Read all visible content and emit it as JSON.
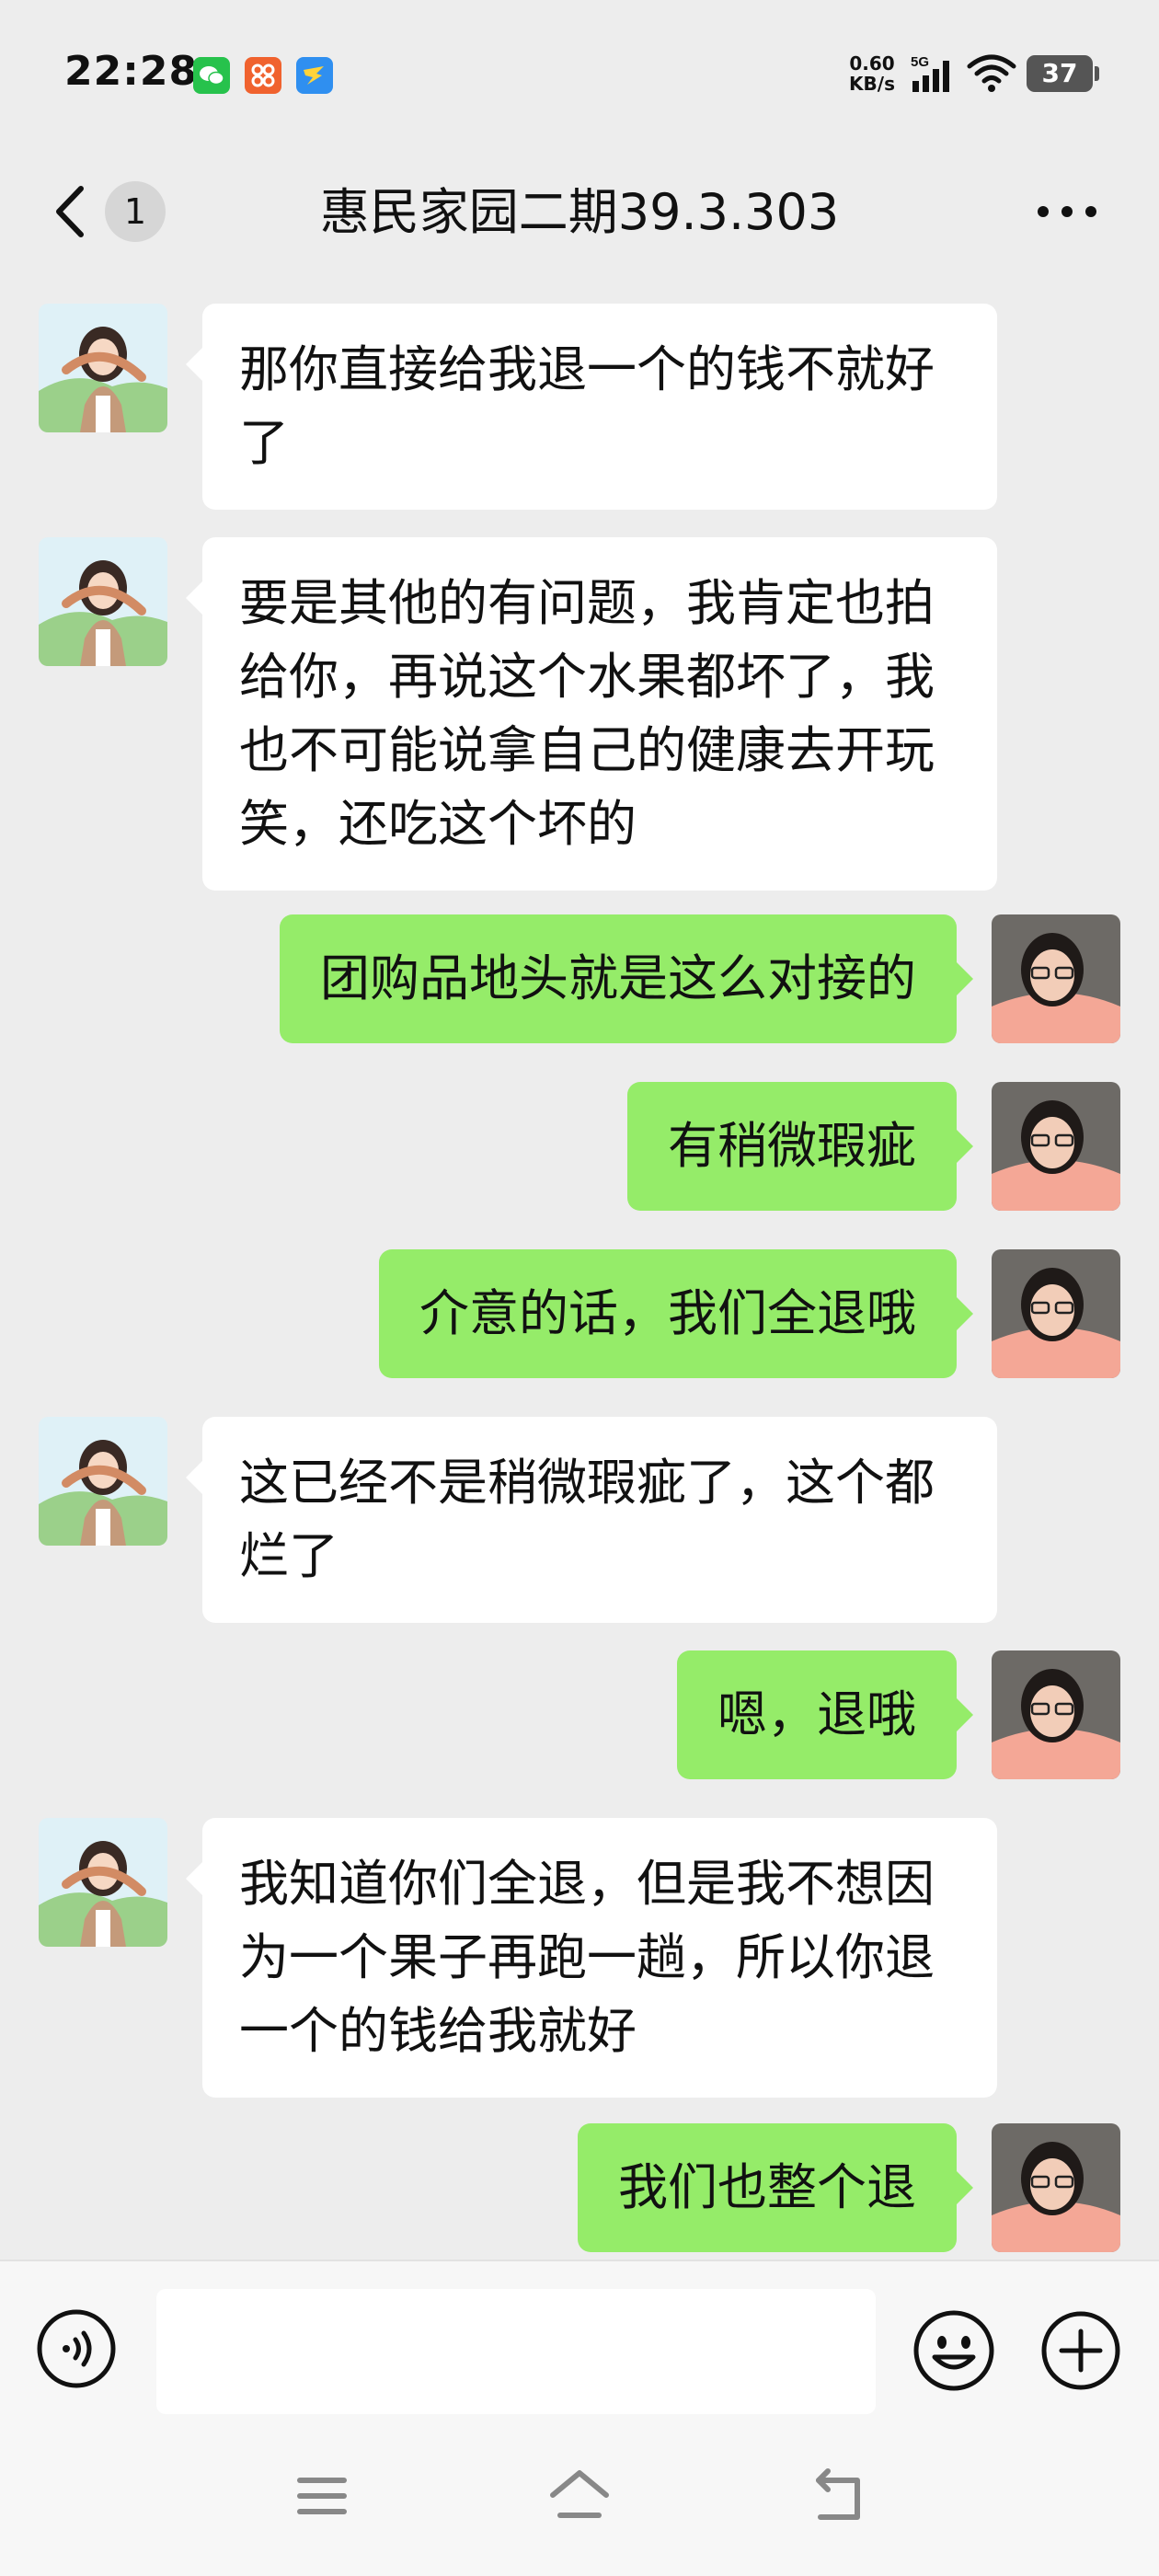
{
  "status_bar": {
    "time": "22:28",
    "net_speed_value": "0.60",
    "net_speed_unit": "KB/s",
    "network_type": "5G",
    "battery_level": "37",
    "notification_icons": [
      "wechat-icon",
      "app-grid-icon",
      "bird-app-icon"
    ]
  },
  "header": {
    "back_icon": "chevron-left-icon",
    "unread_count": "1",
    "title": "惠民家园二期39.3.303",
    "more_icon": "more-dots-icon"
  },
  "messages": [
    {
      "direction": "incoming",
      "text": "那你直接给我退一个的钱不就好了"
    },
    {
      "direction": "incoming",
      "text": "要是其他的有问题，我肯定也拍给你，再说这个水果都坏了，我也不可能说拿自己的健康去开玩笑，还吃这个坏的"
    },
    {
      "direction": "outgoing",
      "text": "团购品地头就是这么对接的"
    },
    {
      "direction": "outgoing",
      "text": "有稍微瑕疵"
    },
    {
      "direction": "outgoing",
      "text": "介意的话，我们全退哦"
    },
    {
      "direction": "incoming",
      "text": "这已经不是稍微瑕疵了，这个都烂了"
    },
    {
      "direction": "outgoing",
      "text": "嗯，退哦"
    },
    {
      "direction": "incoming",
      "text": "我知道你们全退，但是我不想因为一个果子再跑一趟，所以你退一个的钱给我就好"
    },
    {
      "direction": "outgoing",
      "text": "我们也整个退"
    }
  ],
  "input_bar": {
    "voice_icon": "voice-input-icon",
    "input_value": "",
    "emoji_icon": "emoji-icon",
    "plus_icon": "plus-circle-icon"
  },
  "nav_bar": {
    "icons": [
      "menu-icon",
      "home-icon",
      "back-nav-icon"
    ]
  },
  "colors": {
    "background": "#ededed",
    "incoming_bubble": "#ffffff",
    "outgoing_bubble": "#95ec69",
    "input_bar_bg": "#f7f7f7"
  }
}
